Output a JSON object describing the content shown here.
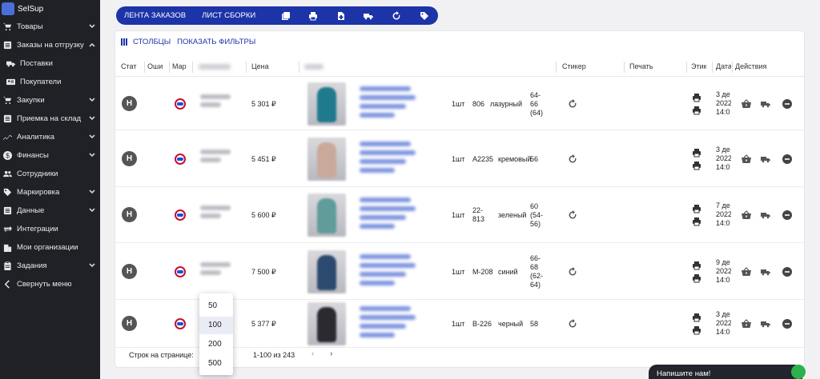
{
  "sidebar": {
    "brand": "SelSup",
    "items": [
      {
        "label": "Товары",
        "icon": "cart-icon",
        "chevron": "down"
      },
      {
        "label": "Заказы на отгрузку",
        "icon": "list-icon",
        "chevron": "up"
      },
      {
        "label": "Поставки",
        "icon": "truck-icon",
        "sub": true
      },
      {
        "label": "Покупатели",
        "icon": "contact-card-icon",
        "sub": true
      },
      {
        "label": "Закупки",
        "icon": "cart-icon",
        "chevron": "down"
      },
      {
        "label": "Приемка на склад",
        "icon": "list-icon",
        "chevron": "down"
      },
      {
        "label": "Аналитика",
        "icon": "chart-line-icon",
        "chevron": "down"
      },
      {
        "label": "Финансы",
        "icon": "dollar-icon",
        "chevron": "down"
      },
      {
        "label": "Сотрудники",
        "icon": "people-icon"
      },
      {
        "label": "Маркировка",
        "icon": "tag-icon",
        "chevron": "down"
      },
      {
        "label": "Данные",
        "icon": "list-icon",
        "chevron": "down"
      },
      {
        "label": "Интеграции",
        "icon": "swap-arrows-icon"
      },
      {
        "label": "Мои организации",
        "icon": "building-icon"
      },
      {
        "label": "Задания",
        "icon": "clipboard-icon",
        "chevron": "down"
      },
      {
        "label": "Свернуть меню",
        "icon": "chevron-left-icon"
      }
    ]
  },
  "toolbar": {
    "feed_label": "ЛЕНТА ЗАКАЗОВ",
    "picklist_label": "ЛИСТ СБОРКИ",
    "icons": [
      "copy-icon",
      "print-icon",
      "add-file-icon",
      "truck-icon",
      "refresh-icon",
      "tag-icon"
    ]
  },
  "panel": {
    "columns_label": "СТОЛБЦЫ",
    "filters_label": "ПОКАЗАТЬ ФИЛЬТРЫ"
  },
  "table": {
    "headers": {
      "status": "Стат",
      "errors": "Оши",
      "marketplace": "Мар",
      "price": "Цена",
      "sticker": "Стикер",
      "print": "Печать",
      "label": "Этик",
      "date": "Дата",
      "actions": "Действия"
    },
    "rows": [
      {
        "status": "Н",
        "price": "5 301 ₽",
        "qty": "1шт",
        "article": "806",
        "color": "лазурный",
        "size": [
          "64-",
          "66",
          "(64)"
        ],
        "date": [
          "3 де",
          "2022",
          "14:0"
        ],
        "thumb_color": "#1e7a8c"
      },
      {
        "status": "Н",
        "price": "5 451 ₽",
        "qty": "1шт",
        "article": "A2235",
        "color": "кремовый",
        "size": [
          "56"
        ],
        "date": [
          "3 де",
          "2022",
          "14:0"
        ],
        "thumb_color": "#c9a99a"
      },
      {
        "status": "Н",
        "price": "5 600 ₽",
        "qty": "1шт",
        "article": "22-\n813",
        "color": "зеленый",
        "size": [
          "60",
          "(54-",
          "56)"
        ],
        "date": [
          "7 де",
          "2022",
          "14:0"
        ],
        "thumb_color": "#5f9c9a"
      },
      {
        "status": "Н",
        "price": "7 500 ₽",
        "qty": "1шт",
        "article": "M-208",
        "color": "синий",
        "size": [
          "66-",
          "68",
          "(62-",
          "64)"
        ],
        "date": [
          "9 де",
          "2022",
          "14:0"
        ],
        "thumb_color": "#2c4a6e"
      },
      {
        "status": "Н",
        "price": "5 377 ₽",
        "qty": "1шт",
        "article": "B-226",
        "color": "черный",
        "size": [
          "58"
        ],
        "date": [
          "3 де",
          "2022",
          "14:0"
        ],
        "thumb_color": "#2a2a30"
      }
    ]
  },
  "pagination": {
    "rows_per_page_label": "Строк на странице:",
    "range": "1-100 из 243",
    "options": [
      "50",
      "100",
      "200",
      "500"
    ],
    "selected": "100"
  },
  "chat": {
    "label": "Напишите нам!"
  },
  "colors": {
    "toolbar": "#1d33a8",
    "sidebar": "#1f2127",
    "link": "#1d33a8",
    "chat_online": "#2bb24c"
  }
}
